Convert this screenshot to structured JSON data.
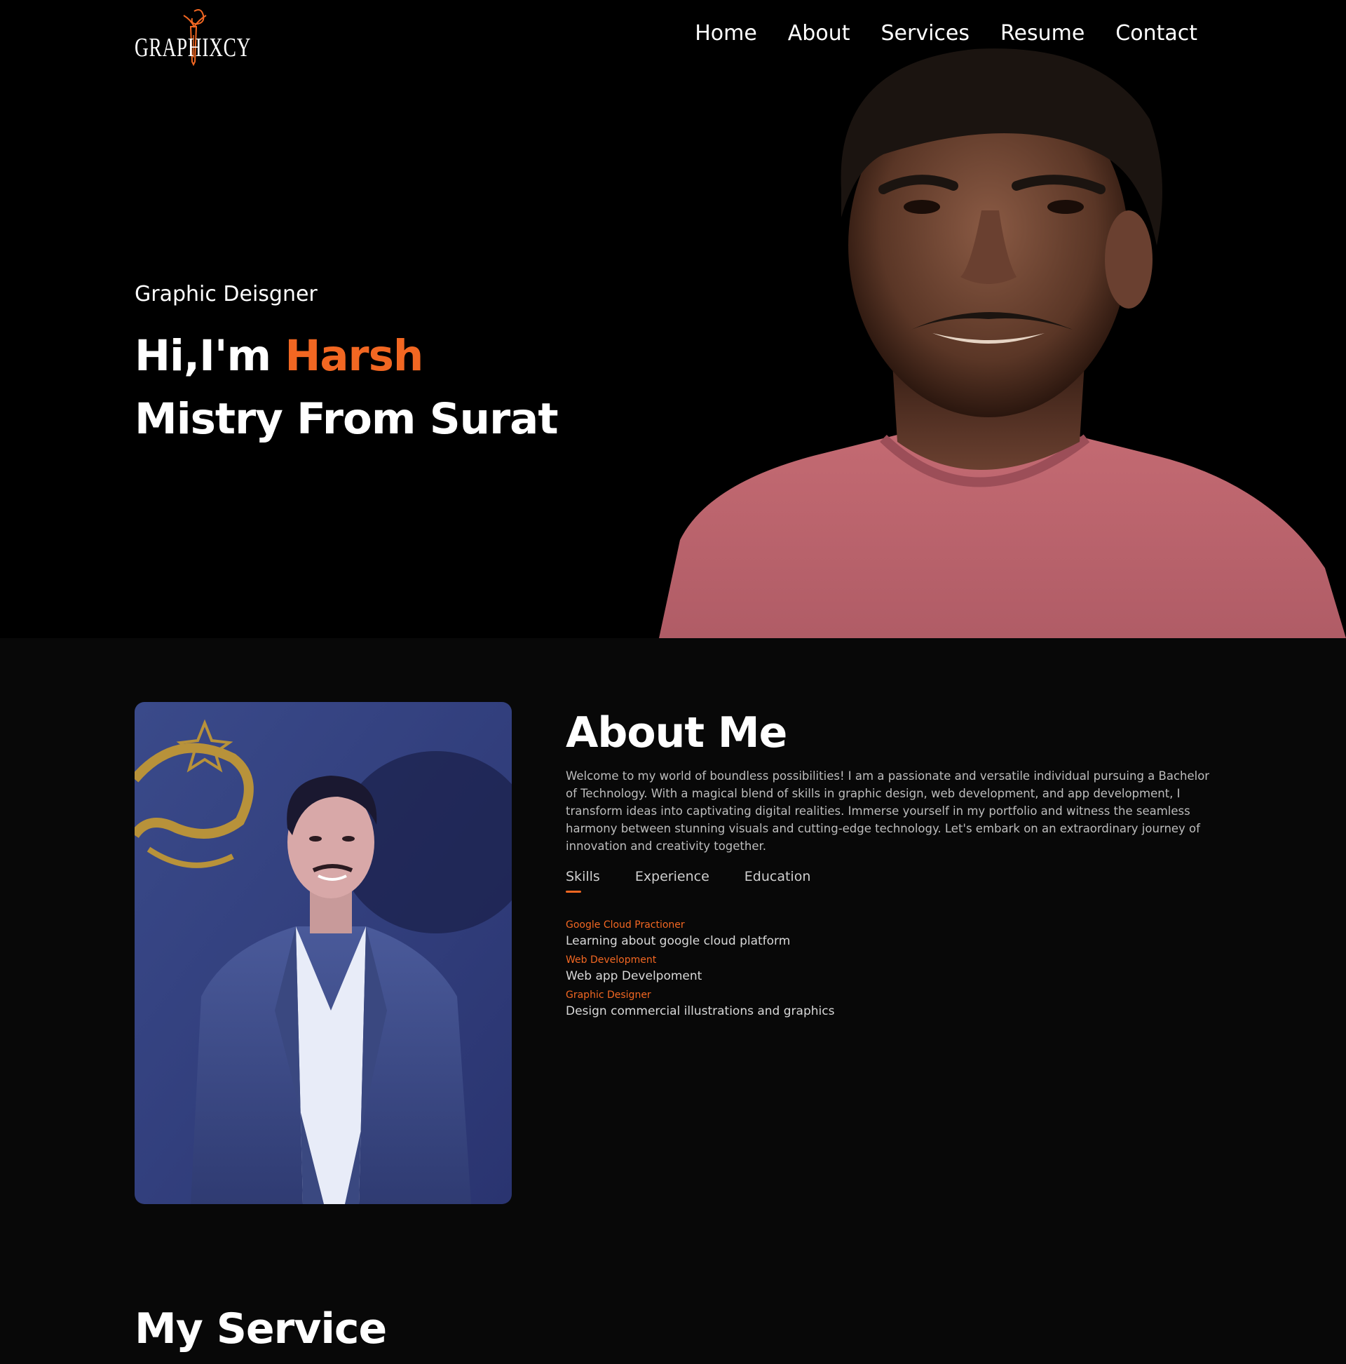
{
  "nav": {
    "logo_text": "GRAPHIXCY",
    "links": [
      "Home",
      "About",
      "Services",
      "Resume",
      "Contact"
    ]
  },
  "hero": {
    "subtitle": "Graphic Deisgner",
    "title_prefix": "Hi,I'm ",
    "title_name": "Harsh",
    "title_line2": "Mistry From Surat"
  },
  "about": {
    "title": "About Me",
    "description": "Welcome to my world of boundless possibilities! I am a passionate and versatile individual pursuing a Bachelor of Technology. With a magical blend of skills in graphic design, web development, and app development, I transform ideas into captivating digital realities. Immerse yourself in my portfolio and witness the seamless harmony between stunning visuals and cutting-edge technology. Let's embark on an extraordinary journey of innovation and creativity together.",
    "tabs": [
      "Skills",
      "Experience",
      "Education"
    ],
    "active_tab": "Skills",
    "skills": [
      {
        "name": "Google Cloud Practioner",
        "desc": "Learning about google cloud platform"
      },
      {
        "name": "Web Development",
        "desc": "Web app Develpoment"
      },
      {
        "name": "Graphic Designer",
        "desc": "Design commercial illustrations and graphics"
      }
    ]
  },
  "services": {
    "title": "My Service"
  },
  "colors": {
    "accent": "#f26722",
    "hero_bg": "#000000",
    "section_bg": "#080808"
  }
}
